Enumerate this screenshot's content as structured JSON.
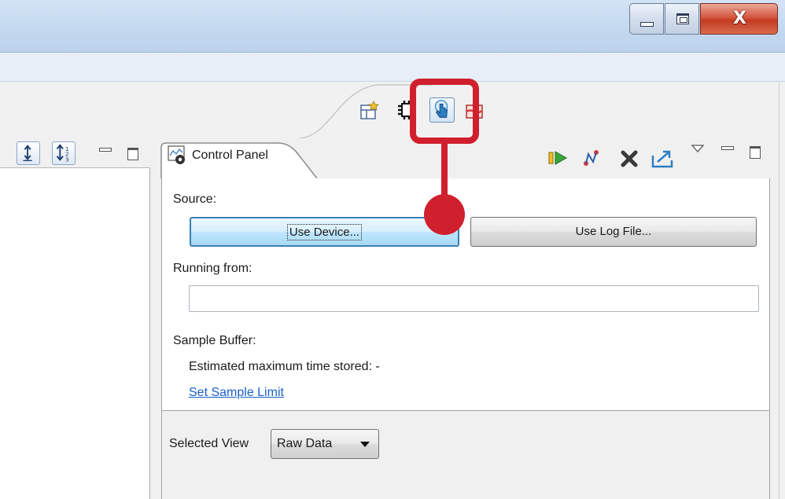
{
  "window": {
    "controls": {
      "minimize_icon": "minimize-icon",
      "maximize_icon": "maximize-icon",
      "close_glyph": "X"
    }
  },
  "toolbar": {
    "icons": [
      "layout-icon",
      "chip-icon",
      "touch-icon",
      "disconnect-icon"
    ],
    "highlighted": "touch-icon"
  },
  "left_view": {
    "icons": [
      "expand-icon",
      "sort-icon",
      "minimize-icon",
      "maximize-icon"
    ]
  },
  "control_panel": {
    "tab_title": "Control Panel",
    "header_icons": [
      "run-icon",
      "connect-icon",
      "stop-icon",
      "export-icon",
      "view-menu-icon",
      "minimize-icon",
      "maximize-icon"
    ],
    "source_label": "Source:",
    "use_device_label": "Use Device...",
    "use_log_file_label": "Use Log File...",
    "running_from_label": "Running from:",
    "running_from_value": "",
    "sample_buffer_label": "Sample Buffer:",
    "estimated_label": "Estimated maximum time stored: -",
    "set_sample_limit_label": "Set Sample Limit",
    "selected_view_label": "Selected View",
    "selected_view_value": "Raw Data"
  },
  "colors": {
    "callout": "#d0202e",
    "link": "#1a5fc9",
    "focus_border": "#3c7fb1"
  }
}
